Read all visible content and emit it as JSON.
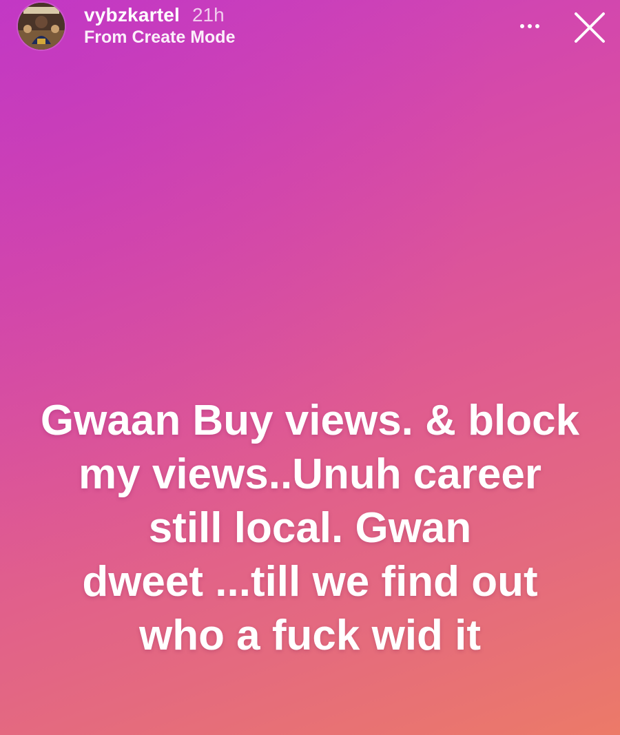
{
  "header": {
    "username": "vybzkartel",
    "timestamp": "21h",
    "subtitle": "From Create Mode",
    "avatar_icon": "profile-avatar",
    "more_icon": "more-horizontal-icon",
    "close_icon": "close-icon"
  },
  "story": {
    "background_colors": [
      "#c63cc4",
      "#df5a92",
      "#ec7a68"
    ],
    "caption_lines": [
      "Gwaan Buy views. & block",
      "my views..Unuh career",
      "still local. Gwan",
      "dweet ...till we find out",
      "who a fuck wid it"
    ]
  }
}
